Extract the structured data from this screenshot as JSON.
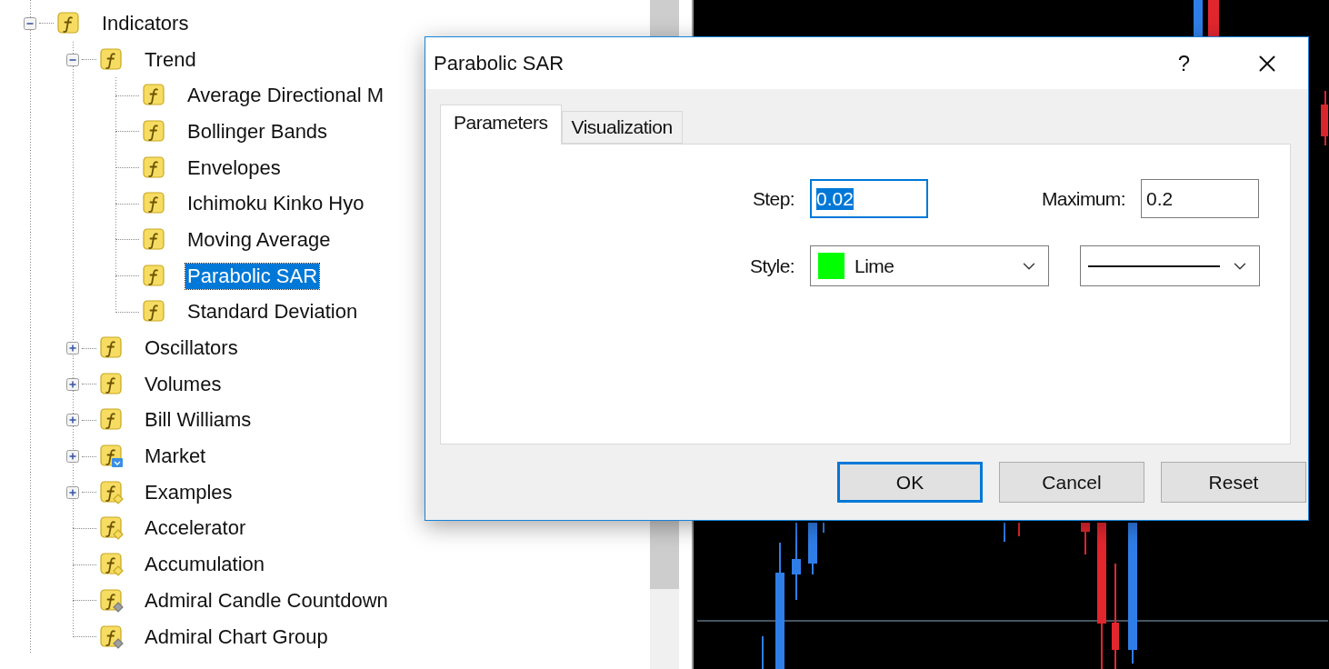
{
  "tree": {
    "items": [
      {
        "label": "Indicators",
        "kind": "function",
        "expanded": true,
        "selected": false,
        "children": [
          {
            "label": "Trend",
            "kind": "function",
            "expanded": true,
            "selected": false,
            "children": [
              {
                "label": "Average Directional M",
                "kind": "function",
                "selected": false
              },
              {
                "label": "Bollinger Bands",
                "kind": "function",
                "selected": false
              },
              {
                "label": "Envelopes",
                "kind": "function",
                "selected": false
              },
              {
                "label": "Ichimoku Kinko Hyo",
                "kind": "function",
                "selected": false
              },
              {
                "label": "Moving Average",
                "kind": "function",
                "selected": false
              },
              {
                "label": "Parabolic SAR",
                "kind": "function",
                "selected": true
              },
              {
                "label": "Standard Deviation",
                "kind": "function",
                "selected": false
              }
            ]
          },
          {
            "label": "Oscillators",
            "kind": "function",
            "expanded": false,
            "selected": false
          },
          {
            "label": "Volumes",
            "kind": "function",
            "expanded": false,
            "selected": false
          },
          {
            "label": "Bill Williams",
            "kind": "function",
            "expanded": false,
            "selected": false
          },
          {
            "label": "Market",
            "kind": "market",
            "expanded": false,
            "selected": false
          },
          {
            "label": "Examples",
            "kind": "custom",
            "expanded": false,
            "selected": false
          },
          {
            "label": "Accelerator",
            "kind": "custom",
            "selected": false
          },
          {
            "label": "Accumulation",
            "kind": "custom",
            "selected": false
          },
          {
            "label": "Admiral Candle Countdown",
            "kind": "custom-grey",
            "selected": false
          },
          {
            "label": "Admiral Chart Group",
            "kind": "custom-grey",
            "selected": false
          }
        ]
      }
    ]
  },
  "dialog": {
    "title": "Parabolic SAR",
    "help_button": "?",
    "tabs": [
      {
        "label": "Parameters",
        "selected": true
      },
      {
        "label": "Visualization",
        "selected": false
      }
    ],
    "fields": [
      {
        "label": "Step:",
        "value": "0.02",
        "focused": true
      },
      {
        "label": "Maximum:",
        "value": "0.2",
        "focused": false
      }
    ],
    "style": {
      "label": "Style:",
      "color_select": {
        "value": "Lime",
        "color": "#00ff00"
      },
      "line_select": {
        "kind": "solid"
      }
    },
    "buttons": [
      {
        "label": "OK",
        "default": true
      },
      {
        "label": "Cancel",
        "default": false
      },
      {
        "label": "Reset",
        "default": false
      }
    ]
  }
}
